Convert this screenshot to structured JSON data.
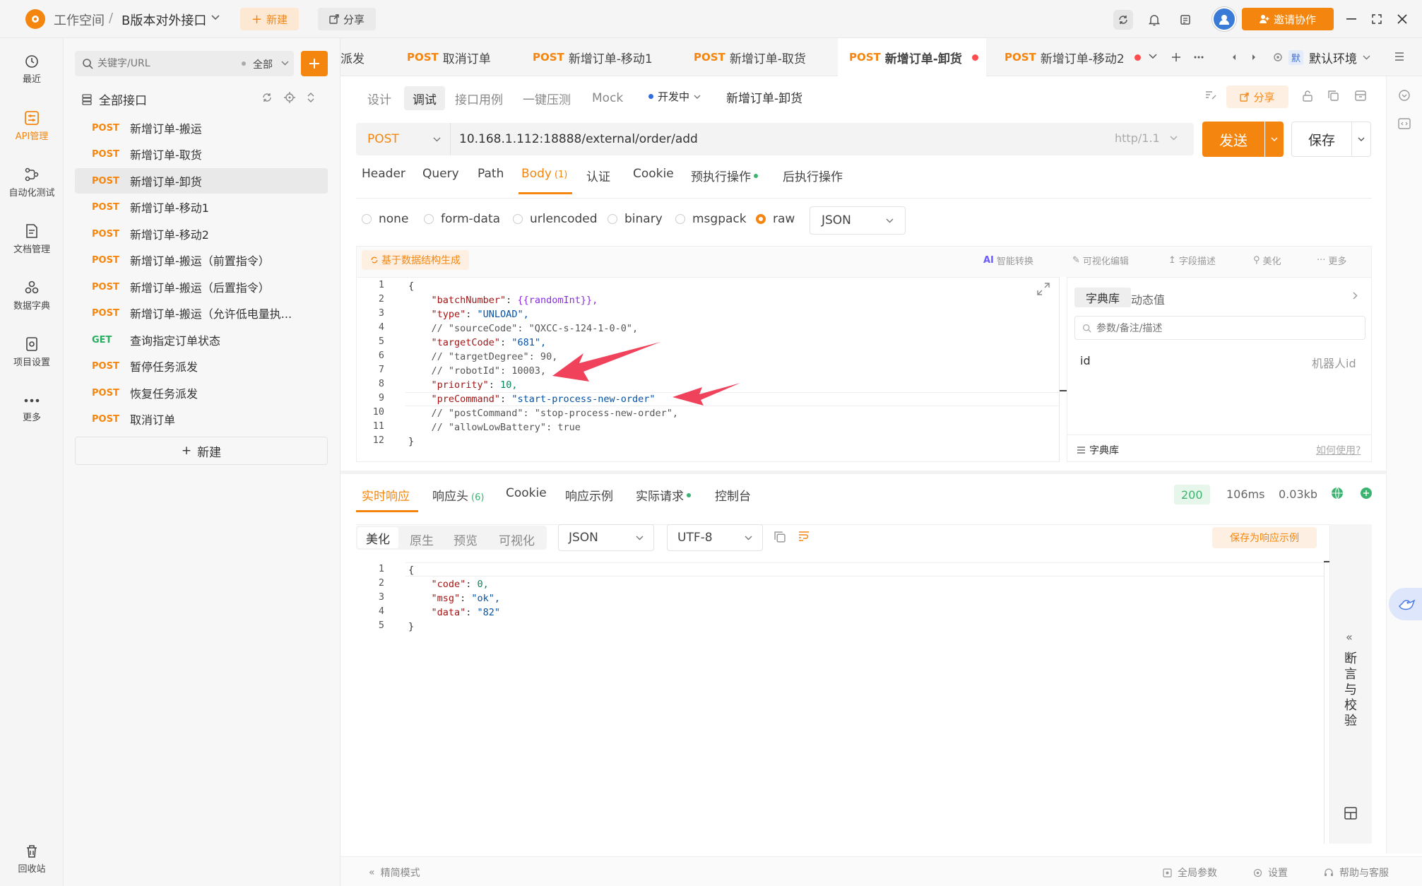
{
  "topbar": {
    "workspace": "工作空间",
    "separator": "/",
    "project": "B版本对外接口",
    "new_label": "新建",
    "share_label": "分享",
    "invite_label": "邀请协作"
  },
  "leftnav": {
    "items": [
      {
        "label": "最近"
      },
      {
        "label": "API管理"
      },
      {
        "label": "自动化测试"
      },
      {
        "label": "文档管理"
      },
      {
        "label": "数据字典"
      },
      {
        "label": "项目设置"
      },
      {
        "label": "更多"
      }
    ],
    "trash_label": "回收站"
  },
  "apilist": {
    "search_placeholder": "关键字/URL",
    "filter_label": "全部",
    "root_label": "全部接口",
    "items": [
      {
        "method": "POST",
        "name": "新增订单-搬运"
      },
      {
        "method": "POST",
        "name": "新增订单-取货"
      },
      {
        "method": "POST",
        "name": "新增订单-卸货"
      },
      {
        "method": "POST",
        "name": "新增订单-移动1"
      },
      {
        "method": "POST",
        "name": "新增订单-移动2"
      },
      {
        "method": "POST",
        "name": "新增订单-搬运（前置指令）"
      },
      {
        "method": "POST",
        "name": "新增订单-搬运（后置指令）"
      },
      {
        "method": "POST",
        "name": "新增订单-搬运（允许低电量执..."
      },
      {
        "method": "GET",
        "name": "查询指定订单状态"
      },
      {
        "method": "POST",
        "name": "暂停任务派发"
      },
      {
        "method": "POST",
        "name": "恢复任务派发"
      },
      {
        "method": "POST",
        "name": "取消订单"
      }
    ],
    "new_label": "新建"
  },
  "tabs": {
    "items": [
      {
        "method": "",
        "name": "派发"
      },
      {
        "method": "POST",
        "name": "取消订单"
      },
      {
        "method": "POST",
        "name": "新增订单-移动1"
      },
      {
        "method": "POST",
        "name": "新增订单-取货"
      },
      {
        "method": "POST",
        "name": "新增订单-卸货"
      },
      {
        "method": "POST",
        "name": "新增订单-移动2"
      }
    ],
    "env_badge": "默",
    "env_label": "默认环境"
  },
  "request": {
    "subtabs": [
      "设计",
      "调试",
      "接口用例",
      "一键压测",
      "Mock"
    ],
    "status": "开发中",
    "title": "新增订单-卸货",
    "share_label": "分享",
    "method": "POST",
    "url": "10.168.1.112:18888/external/order/add",
    "protocol": "http/1.1",
    "send_label": "发送",
    "save_label": "保存",
    "tabs": [
      "Header",
      "Query",
      "Path",
      "Body",
      "认证",
      "Cookie",
      "预执行操作",
      "后执行操作"
    ],
    "body_count": "(1)",
    "body_types": [
      "none",
      "form-data",
      "urlencoded",
      "binary",
      "msgpack",
      "raw"
    ],
    "body_format": "JSON",
    "gen_label": "基于数据结构生成",
    "tools": [
      "智能转换",
      "可视化编辑",
      "字段描述",
      "美化",
      "更多"
    ],
    "code_lines": [
      "{",
      "    \"batchNumber\": {{randomInt}},",
      "    \"type\": \"UNLOAD\",",
      "    // \"sourceCode\": \"QXCC-s-124-1-0-0\",",
      "    \"targetCode\": \"681\",",
      "    // \"targetDegree\": 90,",
      "    // \"robotId\": 10003,",
      "    \"priority\": 10,",
      "    \"preCommand\": \"start-process-new-order\"",
      "    // \"postCommand\": \"stop-process-new-order\",",
      "    // \"allowLowBattery\": true",
      "}"
    ]
  },
  "dict": {
    "tab_dict": "字典库",
    "tab_dynamic": "动态值",
    "search_placeholder": "参数/备注/描述",
    "row_key": "id",
    "row_desc": "机器人id",
    "footer_label": "字典库",
    "help_label": "如何使用?"
  },
  "response": {
    "tabs": [
      "实时响应",
      "响应头",
      "Cookie",
      "响应示例",
      "实际请求",
      "控制台"
    ],
    "header_count": "(6)",
    "status_code": "200",
    "time": "106ms",
    "size": "0.03kb",
    "view_modes": [
      "美化",
      "原生",
      "预览",
      "可视化"
    ],
    "format": "JSON",
    "encoding": "UTF-8",
    "save_example_label": "保存为响应示例",
    "code_lines": [
      "{",
      "    \"code\": 0,",
      "    \"msg\": \"ok\",",
      "    \"data\": \"82\"",
      "}"
    ],
    "assert_label": "断言与校验"
  },
  "footer": {
    "simple_mode": "精简模式",
    "global_params": "全局参数",
    "settings": "设置",
    "help": "帮助与客服"
  },
  "colors": {
    "accent": "#f4860f",
    "post": "#f4860f",
    "get": "#27ae60",
    "arrow": "#f0435b",
    "status_ok": "#3cb371"
  }
}
